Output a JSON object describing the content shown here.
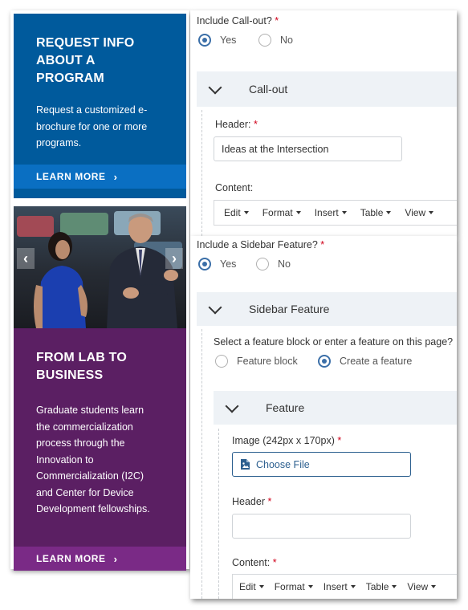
{
  "promo1": {
    "title_lines": [
      "REQUEST INFO",
      "ABOUT A",
      "PROGRAM"
    ],
    "text_lines": [
      "Request a customized e-",
      "brochure for one or more",
      "programs."
    ],
    "cta": "LEARN MORE",
    "bg_color": "#005a9c",
    "bar_color": "#0a6fc2"
  },
  "carousel": {
    "prev_icon": "chevron-left-icon",
    "next_icon": "chevron-right-icon"
  },
  "promo2": {
    "title_lines": [
      "FROM LAB TO",
      "BUSINESS"
    ],
    "text_lines": [
      "Graduate students learn",
      "the commercialization",
      "process through the",
      "Innovation to",
      "Commercialization (I2C)",
      "and Center for Device",
      "Development fellowships."
    ],
    "cta": "LEARN MORE",
    "bg_color": "#5b1f63",
    "bar_color": "#7a2a86"
  },
  "callout_form": {
    "question": "Include Call-out?",
    "options": [
      "Yes",
      "No"
    ],
    "selected": "Yes",
    "section_title": "Call-out",
    "header_label": "Header:",
    "header_value": "Ideas at the Intersection",
    "content_label": "Content:",
    "toolbar": [
      "Edit",
      "Format",
      "Insert",
      "Table",
      "View"
    ]
  },
  "sidebar_form": {
    "question": "Include a Sidebar Feature?",
    "options": [
      "Yes",
      "No"
    ],
    "selected": "Yes",
    "section_title": "Sidebar Feature",
    "select_prompt": "Select a feature block or enter a feature on this page?",
    "feature_options": [
      "Feature block",
      "Create a feature"
    ],
    "feature_selected": "Create a feature",
    "feature_section_title": "Feature",
    "image_label": "Image (242px x 170px)",
    "choose_file": "Choose File",
    "header_label": "Header",
    "header_value": "",
    "content_label": "Content:",
    "toolbar": [
      "Edit",
      "Format",
      "Insert",
      "Table",
      "View"
    ]
  },
  "colors": {
    "required": "#d0021b",
    "radio_selected": "#3b6fa8",
    "section_bg": "#eef2f6"
  }
}
